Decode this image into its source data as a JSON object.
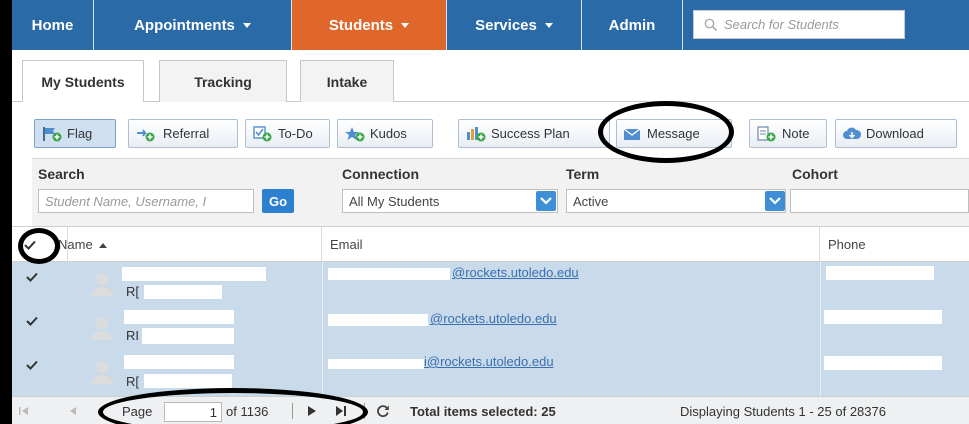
{
  "nav": {
    "home": "Home",
    "appointments": "Appointments",
    "students": "Students",
    "services": "Services",
    "admin": "Admin",
    "search_placeholder": "Search for Students"
  },
  "tabs": [
    "My Students",
    "Tracking",
    "Intake"
  ],
  "toolbar": {
    "flag": "Flag",
    "referral": "Referral",
    "todo": "To-Do",
    "kudos": "Kudos",
    "success_plan": "Success Plan",
    "message": "Message",
    "note": "Note",
    "download": "Download"
  },
  "filters": {
    "search_label": "Search",
    "search_placeholder": "Student Name, Username, I",
    "go": "Go",
    "connection_label": "Connection",
    "connection_value": "All My Students",
    "term_label": "Term",
    "term_value": "Active",
    "cohort_label": "Cohort"
  },
  "grid": {
    "col_name": "Name",
    "col_email": "Email",
    "col_phone": "Phone",
    "rows": [
      {
        "name_line2": "R[",
        "email": "@rockets.utoledo.edu"
      },
      {
        "name_line2": "RI",
        "email": "@rockets.utoledo.edu"
      },
      {
        "name_line2": "R[",
        "email": "i@rockets.utoledo.edu"
      }
    ]
  },
  "pager": {
    "page_label": "Page",
    "page_value": "1",
    "of_label": "of 1136",
    "selected": "Total items selected: 25",
    "displaying": "Displaying Students 1 - 25 of 28376"
  },
  "colors": {
    "nav_blue": "#2a6aa6",
    "students_orange": "#e0672c",
    "row_selected": "#c9dbeb"
  }
}
